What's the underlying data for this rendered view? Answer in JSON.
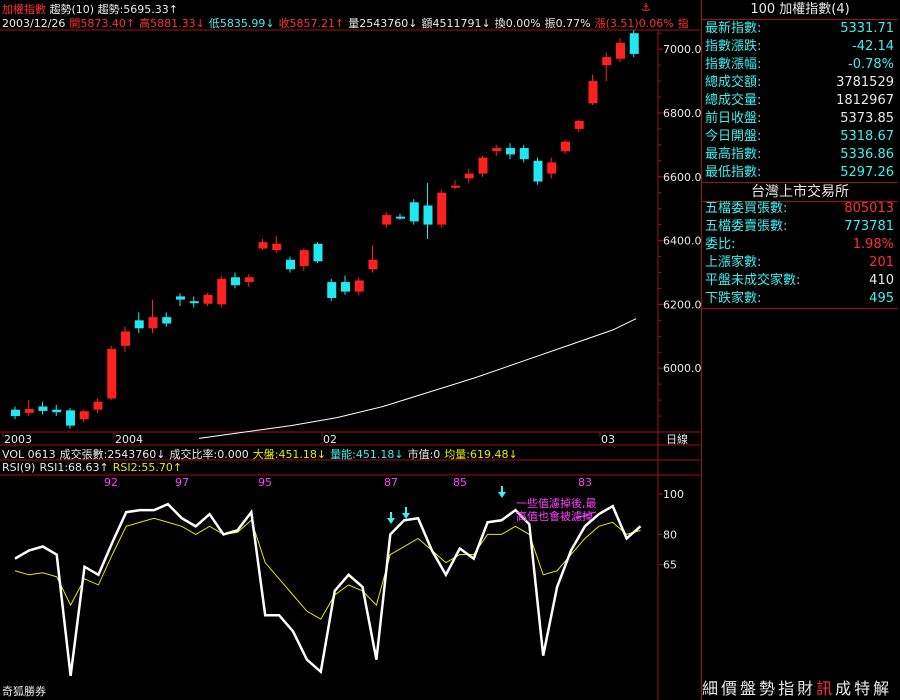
{
  "main_chart": {
    "title": "加權指數",
    "trend_label": "趨勢(10)",
    "trend_value": "趨勢:5695.33↑",
    "quote_line": [
      {
        "text": "2003/12/26",
        "color": "white"
      },
      {
        "text": "開5873.40↑",
        "color": "red"
      },
      {
        "text": "高5881.33↓",
        "color": "red"
      },
      {
        "text": "低5835.99↓",
        "color": "cyan"
      },
      {
        "text": "收5857.21↑",
        "color": "red"
      },
      {
        "text": "量2543760↓",
        "color": "white"
      },
      {
        "text": "額4511791↓",
        "color": "white"
      },
      {
        "text": "換0.00%",
        "color": "white"
      },
      {
        "text": "振0.77%",
        "color": "white"
      },
      {
        "text": "漲(3.51)0.06%",
        "color": "red"
      },
      {
        "text": "指",
        "color": "red"
      }
    ],
    "price_ticks": [
      "7000.0",
      "6800.0",
      "6600.0",
      "6400.0",
      "6200.0",
      "6000.0"
    ],
    "date_ticks": [
      "2003",
      "2004",
      "02",
      "03"
    ],
    "date_axis_label": "日線"
  },
  "vol_line": [
    {
      "text": "VOL 0613",
      "color": "white"
    },
    {
      "text": "成交張數:2543760↓",
      "color": "white"
    },
    {
      "text": "成交比率:0.000",
      "color": "white"
    },
    {
      "text": "大盤:451.18↓",
      "color": "yellow"
    },
    {
      "text": "量能:451.18↓",
      "color": "cyan"
    },
    {
      "text": "市值:0",
      "color": "white"
    },
    {
      "text": "均量:619.48↓",
      "color": "yellow"
    }
  ],
  "rsi": {
    "label_line": [
      {
        "text": "RSI(9)",
        "color": "white"
      },
      {
        "text": "RSI1:68.63↑",
        "color": "white"
      },
      {
        "text": "RSI2:55.70↑",
        "color": "yellow"
      }
    ],
    "peak_labels": [
      "92",
      "97",
      "95",
      "87",
      "85",
      "83"
    ],
    "ticks": [
      "100",
      "80",
      "65"
    ],
    "annotation_line1": "一些值濾掉後,最",
    "annotation_line2": "高值也會被濾掉"
  },
  "footer_brand": "奇狐勝券",
  "info_panel": {
    "header": "100 加權指數(4)",
    "index_rows": [
      {
        "label": "最新指數:",
        "value": "5331.71",
        "color": "cyan"
      },
      {
        "label": "指數漲跌:",
        "value": "-42.14",
        "color": "cyan"
      },
      {
        "label": "指數漲幅:",
        "value": "-0.78%",
        "color": "cyan"
      },
      {
        "label": "總成交額:",
        "value": "3781529",
        "color": "white"
      },
      {
        "label": "總成交量:",
        "value": "1812967",
        "color": "white"
      },
      {
        "label": "前日收盤:",
        "value": "5373.85",
        "color": "white"
      },
      {
        "label": "今日開盤:",
        "value": "5318.67",
        "color": "cyan"
      },
      {
        "label": "最高指數:",
        "value": "5336.86",
        "color": "cyan"
      },
      {
        "label": "最低指數:",
        "value": "5297.26",
        "color": "cyan"
      }
    ],
    "exchange_header": "台灣上市交易所",
    "exchange_rows": [
      {
        "label": "五檔委買張數:",
        "value": "805013",
        "color": "red"
      },
      {
        "label": "五檔委賣張數:",
        "value": "773781",
        "color": "cyan"
      },
      {
        "label": "委比:",
        "value": "1.98%",
        "color": "red"
      },
      {
        "label": "上漲家數:",
        "value": "201",
        "color": "red"
      },
      {
        "label": "平盤未成交家數:",
        "value": "410",
        "color": "white"
      },
      {
        "label": "下跌家數:",
        "value": "495",
        "color": "cyan"
      }
    ],
    "bottom_tabs": [
      {
        "text": "細",
        "color": "white"
      },
      {
        "text": "價",
        "color": "white"
      },
      {
        "text": "盤",
        "color": "white"
      },
      {
        "text": "勢",
        "color": "white"
      },
      {
        "text": "指",
        "color": "white"
      },
      {
        "text": "財",
        "color": "white"
      },
      {
        "text": "訊",
        "color": "red"
      },
      {
        "text": "成",
        "color": "white"
      },
      {
        "text": "特",
        "color": "white"
      },
      {
        "text": "解",
        "color": "white"
      }
    ]
  },
  "colors": {
    "up": "#ff2020",
    "down": "#20e8f0",
    "grid": "#a01010",
    "ma": "#ffffff",
    "rsi2": "#e8e800"
  },
  "candles": [
    {
      "o": 5870,
      "c": 5850,
      "h": 5880,
      "l": 5840
    },
    {
      "o": 5860,
      "c": 5872,
      "h": 5900,
      "l": 5850
    },
    {
      "o": 5880,
      "c": 5866,
      "h": 5895,
      "l": 5855
    },
    {
      "o": 5870,
      "c": 5862,
      "h": 5885,
      "l": 5850
    },
    {
      "o": 5868,
      "c": 5820,
      "h": 5875,
      "l": 5810
    },
    {
      "o": 5840,
      "c": 5865,
      "h": 5870,
      "l": 5830
    },
    {
      "o": 5870,
      "c": 5895,
      "h": 5905,
      "l": 5860
    },
    {
      "o": 5905,
      "c": 6060,
      "h": 6070,
      "l": 5900
    },
    {
      "o": 6070,
      "c": 6115,
      "h": 6130,
      "l": 6050
    },
    {
      "o": 6150,
      "c": 6125,
      "h": 6175,
      "l": 6110
    },
    {
      "o": 6125,
      "c": 6160,
      "h": 6215,
      "l": 6110
    },
    {
      "o": 6160,
      "c": 6140,
      "h": 6175,
      "l": 6130
    },
    {
      "o": 6225,
      "c": 6215,
      "h": 6235,
      "l": 6195
    },
    {
      "o": 6210,
      "c": 6205,
      "h": 6225,
      "l": 6190
    },
    {
      "o": 6202,
      "c": 6230,
      "h": 6235,
      "l": 6195
    },
    {
      "o": 6200,
      "c": 6280,
      "h": 6290,
      "l": 6190
    },
    {
      "o": 6285,
      "c": 6260,
      "h": 6300,
      "l": 6250
    },
    {
      "o": 6270,
      "c": 6285,
      "h": 6295,
      "l": 6255
    },
    {
      "o": 6375,
      "c": 6395,
      "h": 6405,
      "l": 6370
    },
    {
      "o": 6370,
      "c": 6390,
      "h": 6415,
      "l": 6360
    },
    {
      "o": 6340,
      "c": 6310,
      "h": 6350,
      "l": 6300
    },
    {
      "o": 6320,
      "c": 6370,
      "h": 6375,
      "l": 6305
    },
    {
      "o": 6390,
      "c": 6335,
      "h": 6395,
      "l": 6330
    },
    {
      "o": 6270,
      "c": 6220,
      "h": 6280,
      "l": 6210
    },
    {
      "o": 6270,
      "c": 6240,
      "h": 6290,
      "l": 6230
    },
    {
      "o": 6240,
      "c": 6275,
      "h": 6285,
      "l": 6230
    },
    {
      "o": 6310,
      "c": 6340,
      "h": 6385,
      "l": 6300
    },
    {
      "o": 6450,
      "c": 6480,
      "h": 6490,
      "l": 6440
    },
    {
      "o": 6475,
      "c": 6470,
      "h": 6485,
      "l": 6465
    },
    {
      "o": 6520,
      "c": 6460,
      "h": 6530,
      "l": 6450
    },
    {
      "o": 6510,
      "c": 6450,
      "h": 6580,
      "l": 6405
    },
    {
      "o": 6450,
      "c": 6550,
      "h": 6560,
      "l": 6440
    },
    {
      "o": 6570,
      "c": 6572,
      "h": 6590,
      "l": 6560
    },
    {
      "o": 6595,
      "c": 6610,
      "h": 6625,
      "l": 6580
    },
    {
      "o": 6610,
      "c": 6660,
      "h": 6665,
      "l": 6600
    },
    {
      "o": 6680,
      "c": 6690,
      "h": 6700,
      "l": 6665
    },
    {
      "o": 6690,
      "c": 6670,
      "h": 6705,
      "l": 6655
    },
    {
      "o": 6690,
      "c": 6655,
      "h": 6700,
      "l": 6645
    },
    {
      "o": 6650,
      "c": 6585,
      "h": 6660,
      "l": 6575
    },
    {
      "o": 6610,
      "c": 6645,
      "h": 6660,
      "l": 6595
    },
    {
      "o": 6680,
      "c": 6710,
      "h": 6715,
      "l": 6670
    },
    {
      "o": 6750,
      "c": 6775,
      "h": 6780,
      "l": 6740
    },
    {
      "o": 6830,
      "c": 6900,
      "h": 6920,
      "l": 6825
    },
    {
      "o": 6950,
      "c": 6975,
      "h": 6990,
      "l": 6900
    },
    {
      "o": 6970,
      "c": 7020,
      "h": 7035,
      "l": 6960
    },
    {
      "o": 7050,
      "c": 6985,
      "h": 7060,
      "l": 6975
    }
  ],
  "ma_line": [
    {
      "i": 16,
      "v": 5780
    },
    {
      "i": 20,
      "v": 5800
    },
    {
      "i": 24,
      "v": 5820
    },
    {
      "i": 28,
      "v": 5845
    },
    {
      "i": 32,
      "v": 5880
    },
    {
      "i": 36,
      "v": 5925
    },
    {
      "i": 40,
      "v": 5970
    },
    {
      "i": 44,
      "v": 6020
    },
    {
      "i": 48,
      "v": 6070
    },
    {
      "i": 52,
      "v": 6120
    },
    {
      "i": 54,
      "v": 6155
    }
  ],
  "rsi1": [
    68,
    72,
    74,
    70,
    10,
    64,
    60,
    76,
    91,
    92,
    92,
    95,
    88,
    84,
    90,
    80,
    82,
    91,
    40,
    40,
    32,
    18,
    12,
    52,
    60,
    54,
    18,
    80,
    87,
    88,
    72,
    60,
    73,
    68,
    86,
    87,
    92,
    85,
    20,
    54,
    72,
    84,
    90,
    94,
    78,
    84
  ],
  "rsi2": [
    62,
    60,
    61,
    59,
    45,
    58,
    55,
    70,
    84,
    86,
    88,
    86,
    84,
    80,
    84,
    80,
    81,
    87,
    66,
    58,
    50,
    42,
    38,
    50,
    55,
    52,
    45,
    70,
    74,
    78,
    72,
    66,
    70,
    70,
    80,
    80,
    84,
    80,
    60,
    62,
    70,
    78,
    84,
    86,
    80,
    82
  ]
}
